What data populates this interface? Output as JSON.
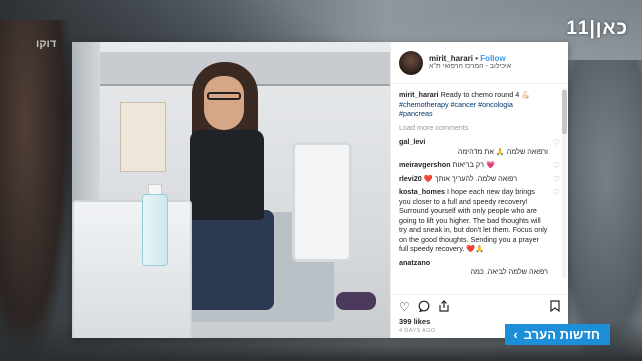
{
  "broadcast": {
    "channel_logo": "11|כאן",
    "watermark": "דוקו",
    "news_tag": "חדשות הערב",
    "news_chevron": "‹"
  },
  "post": {
    "username": "mirit_harari",
    "follow_label": "Follow",
    "location": "איכילוב - המרכז הרפואי ת\"א",
    "caption": {
      "user": "mirit_harari",
      "text": "Ready to chemo round 4 💪🏻",
      "tags": [
        "#chemotherapy",
        "#cancer",
        "#oncologia",
        "#pancreas"
      ]
    },
    "load_more": "Load more comments",
    "comments": [
      {
        "user": "gal_levi",
        "text": "ורפואה שלמה 🙏 את מדהימה",
        "rtl": true
      },
      {
        "user": "meiravgershon",
        "text": "רק בריאות 💗",
        "rtl": true
      },
      {
        "user": "rlevi20",
        "text": "❤️ רפואה שלמה. להעריך אותך",
        "rtl": true
      },
      {
        "user": "kosta_homes",
        "text": "I hope each new day brings you closer to a full and speedy recovery! Surround yourself with only people who are going to lift you higher. The bad thoughts will try and sneak in, but don't let them. Focus only on the good thoughts. Sending you a prayer full speedy recovery. ❤️🙏",
        "rtl": false
      },
      {
        "user": "anatzano",
        "text": "רפואה שלמה לביאה. כמה",
        "rtl": true
      }
    ],
    "likes": "399 likes",
    "date": "4 DAYS AGO",
    "icons": {
      "like": "heart-icon",
      "comment": "comment-icon",
      "share": "share-icon",
      "save": "bookmark-icon"
    }
  },
  "colors": {
    "news_tag": "#1d8fd9",
    "link": "#3897f0",
    "hashtag": "#003569"
  }
}
